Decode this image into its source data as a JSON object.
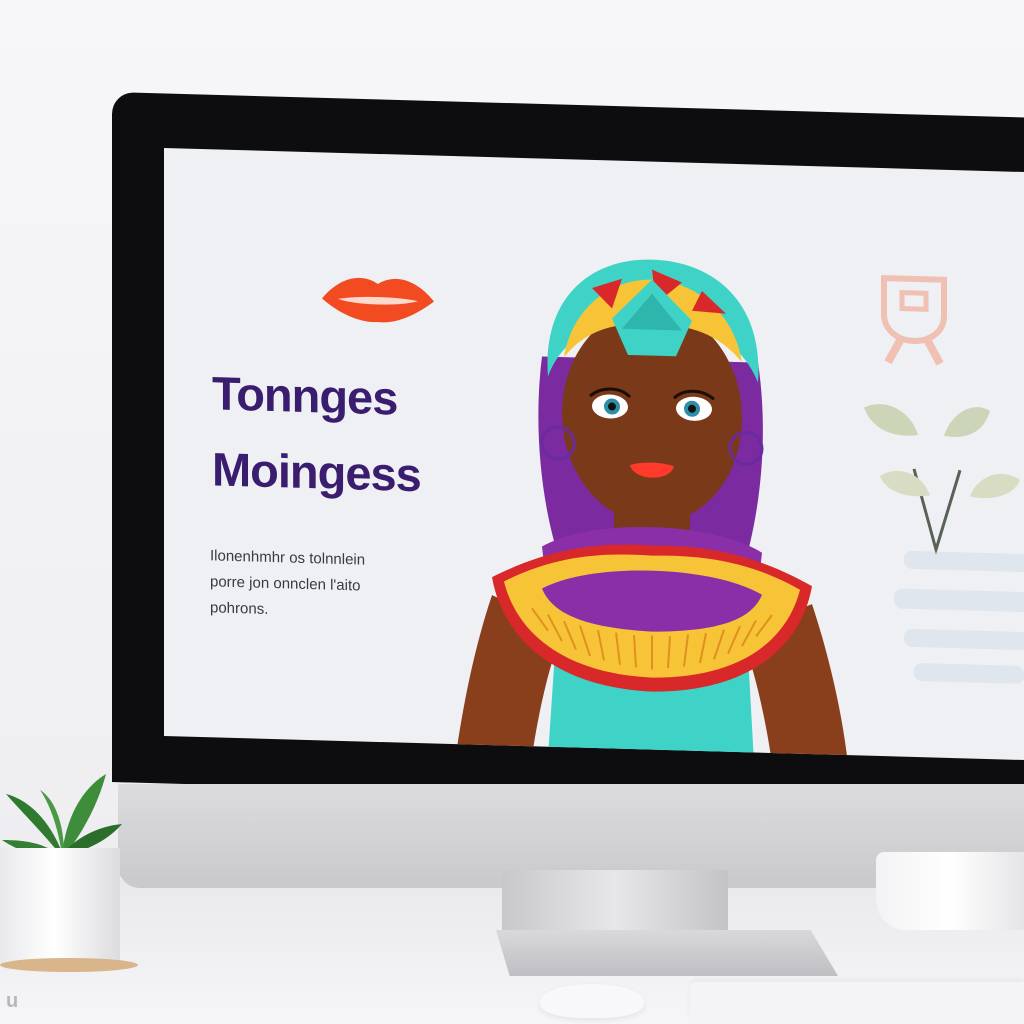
{
  "slide": {
    "title_line1": "Tonnges",
    "title_line2": "Moingess",
    "body_line1": "Ilonenhmhr os tolnnlein",
    "body_line2": "porre jon onnclen l'aito",
    "body_line3": "pohrons."
  },
  "colors": {
    "title": "#3a1d6e",
    "lips": "#f24b22",
    "skin": "#7a3a1a",
    "collar": "#f7c437",
    "accent_red": "#d9282a",
    "purple": "#8b2fa8",
    "teal": "#44d6cc"
  },
  "icons": [
    "lips-icon",
    "ribbon-emblem-icon",
    "leaf-sprig-icon"
  ]
}
